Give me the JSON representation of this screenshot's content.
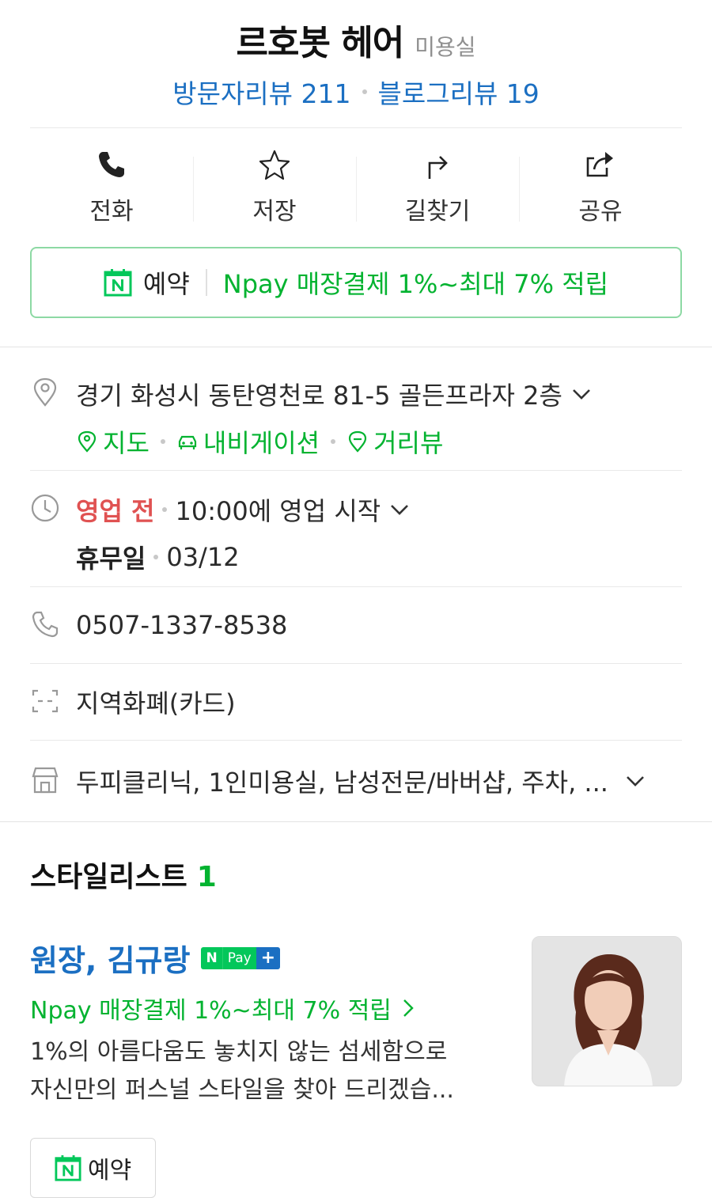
{
  "header": {
    "name": "르호봇 헤어",
    "category": "미용실",
    "visitor_reviews": "방문자리뷰 211",
    "blog_reviews": "블로그리뷰 19"
  },
  "actions": {
    "call": "전화",
    "save": "저장",
    "directions": "길찾기",
    "share": "공유"
  },
  "booking": {
    "label": "예약",
    "npay": "Npay 매장결제 1%~최대 7% 적립"
  },
  "address": {
    "text": "경기 화성시 동탄영천로 81-5 골든프라자 2층",
    "map": "지도",
    "navigation": "내비게이션",
    "street_view": "거리뷰"
  },
  "hours": {
    "status": "영업 전",
    "start": "10:00에 영업 시작",
    "holiday_label": "휴무일",
    "holiday_date": "03/12"
  },
  "phone": "0507-1337-8538",
  "payment": "지역화폐(카드)",
  "features": "두피클리닉, 1인미용실, 남성전문/바버샵, 주차, ...",
  "stylists": {
    "title": "스타일리스트",
    "count": "1",
    "item": {
      "name": "원장, 김규랑",
      "badge_n": "N",
      "badge_pay": "Pay",
      "badge_plus": "+",
      "npay": "Npay 매장결제 1%~최대 7% 적립",
      "desc_line1": "1%의 아름다움도 놓치지 않는 섬세함으로",
      "desc_line2": "자신만의 퍼스널 스타일을 찾아 드리겠습...",
      "book": "예약"
    }
  },
  "colors": {
    "blue": "#1b6fc2",
    "green": "#03b330",
    "red": "#e05252"
  }
}
